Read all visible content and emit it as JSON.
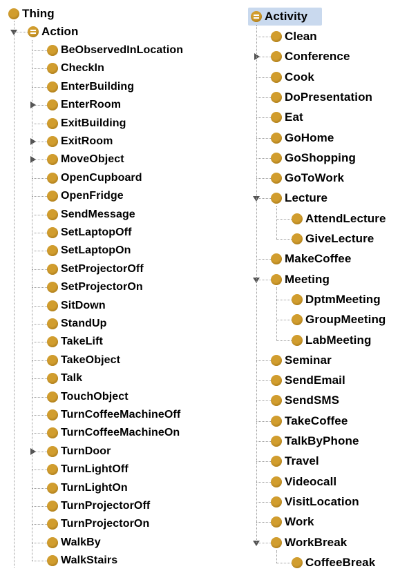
{
  "left_tree": {
    "root": "Thing",
    "parent": "Action",
    "items": [
      {
        "label": "BeObservedInLocation",
        "expandable": false
      },
      {
        "label": "CheckIn",
        "expandable": false
      },
      {
        "label": "EnterBuilding",
        "expandable": false
      },
      {
        "label": "EnterRoom",
        "expandable": true
      },
      {
        "label": "ExitBuilding",
        "expandable": false
      },
      {
        "label": "ExitRoom",
        "expandable": true
      },
      {
        "label": "MoveObject",
        "expandable": true
      },
      {
        "label": "OpenCupboard",
        "expandable": false
      },
      {
        "label": "OpenFridge",
        "expandable": false
      },
      {
        "label": "SendMessage",
        "expandable": false
      },
      {
        "label": "SetLaptopOff",
        "expandable": false
      },
      {
        "label": "SetLaptopOn",
        "expandable": false
      },
      {
        "label": "SetProjectorOff",
        "expandable": false
      },
      {
        "label": "SetProjectorOn",
        "expandable": false
      },
      {
        "label": "SitDown",
        "expandable": false
      },
      {
        "label": "StandUp",
        "expandable": false
      },
      {
        "label": "TakeLift",
        "expandable": false
      },
      {
        "label": "TakeObject",
        "expandable": false
      },
      {
        "label": "Talk",
        "expandable": false
      },
      {
        "label": "TouchObject",
        "expandable": false
      },
      {
        "label": "TurnCoffeeMachineOff",
        "expandable": false
      },
      {
        "label": "TurnCoffeeMachineOn",
        "expandable": false
      },
      {
        "label": "TurnDoor",
        "expandable": true
      },
      {
        "label": "TurnLightOff",
        "expandable": false
      },
      {
        "label": "TurnLightOn",
        "expandable": false
      },
      {
        "label": "TurnProjectorOff",
        "expandable": false
      },
      {
        "label": "TurnProjectorOn",
        "expandable": false
      },
      {
        "label": "WalkBy",
        "expandable": false
      },
      {
        "label": "WalkStairs",
        "expandable": false
      }
    ]
  },
  "right_tree": {
    "parent": "Activity",
    "items": [
      {
        "label": "Clean",
        "state": "leaf"
      },
      {
        "label": "Conference",
        "state": "collapsed"
      },
      {
        "label": "Cook",
        "state": "leaf"
      },
      {
        "label": "DoPresentation",
        "state": "leaf"
      },
      {
        "label": "Eat",
        "state": "leaf"
      },
      {
        "label": "GoHome",
        "state": "leaf"
      },
      {
        "label": "GoShopping",
        "state": "leaf"
      },
      {
        "label": "GoToWork",
        "state": "leaf"
      },
      {
        "label": "Lecture",
        "state": "expanded",
        "children": [
          "AttendLecture",
          "GiveLecture"
        ]
      },
      {
        "label": "MakeCoffee",
        "state": "leaf"
      },
      {
        "label": "Meeting",
        "state": "expanded",
        "children": [
          "DptmMeeting",
          "GroupMeeting",
          "LabMeeting"
        ]
      },
      {
        "label": "Seminar",
        "state": "leaf"
      },
      {
        "label": "SendEmail",
        "state": "leaf"
      },
      {
        "label": "SendSMS",
        "state": "leaf"
      },
      {
        "label": "TakeCoffee",
        "state": "leaf"
      },
      {
        "label": "TalkByPhone",
        "state": "leaf"
      },
      {
        "label": "Travel",
        "state": "leaf"
      },
      {
        "label": "Videocall",
        "state": "leaf"
      },
      {
        "label": "VisitLocation",
        "state": "leaf"
      },
      {
        "label": "Work",
        "state": "leaf"
      },
      {
        "label": "WorkBreak",
        "state": "expanded",
        "children": [
          "CoffeeBreak"
        ]
      }
    ]
  }
}
